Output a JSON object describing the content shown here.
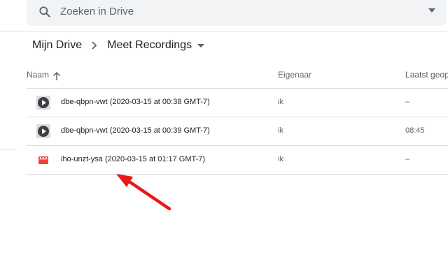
{
  "search": {
    "placeholder": "Zoeken in Drive"
  },
  "breadcrumb": {
    "root": "Mijn Drive",
    "current": "Meet Recordings"
  },
  "columns": {
    "name": "Naam",
    "owner": "Eigenaar",
    "modified": "Laatst geope"
  },
  "files": [
    {
      "name": "dbe-qbpn-vwt (2020-03-15 at 00:38 GMT-7)",
      "owner": "ik",
      "modified": "–",
      "icon": "video-play-icon"
    },
    {
      "name": "dbe-qbpn-vwt (2020-03-15 at 00:39 GMT-7)",
      "owner": "ik",
      "modified": "08:45",
      "icon": "video-play-icon"
    },
    {
      "name": "iho-unzt-ysa (2020-03-15 at 01:17 GMT-7)",
      "owner": "ik",
      "modified": "–",
      "icon": "video-file-icon"
    }
  ],
  "colors": {
    "annotation_arrow": "#e8191b",
    "video_file_icon": "#ea4335",
    "play_icon_bg": "#3c4043"
  }
}
